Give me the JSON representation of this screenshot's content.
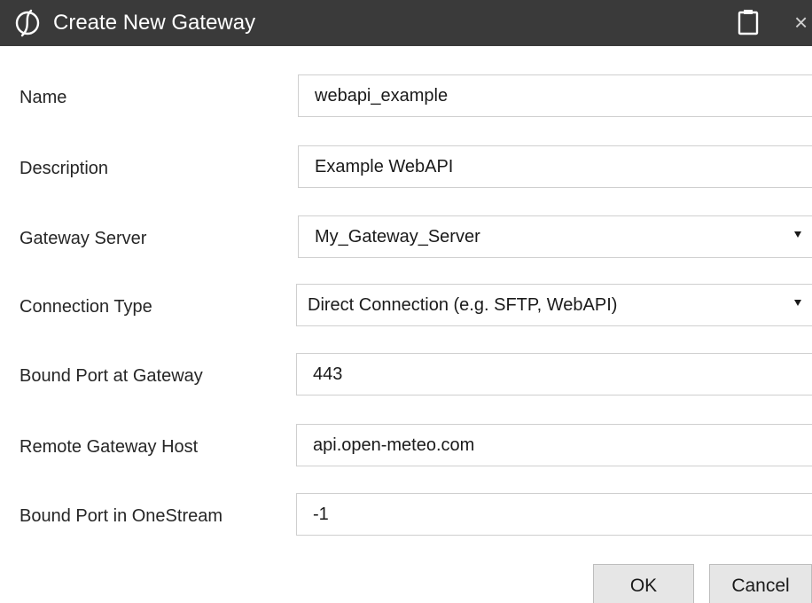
{
  "titlebar": {
    "title": "Create New Gateway",
    "logo_icon": "onestream-logo-icon",
    "restore_icon": "clipboard-icon",
    "close_label": "×",
    "background": "#3a3a3a"
  },
  "form": {
    "name": {
      "label": "Name",
      "value": "webapi_example"
    },
    "description": {
      "label": "Description",
      "value": "Example WebAPI"
    },
    "gateway_server": {
      "label": "Gateway Server",
      "value": "My_Gateway_Server"
    },
    "connection_type": {
      "label": "Connection Type",
      "value": "Direct Connection (e.g. SFTP, WebAPI)"
    },
    "bound_port_gateway": {
      "label": "Bound Port at Gateway",
      "value": "443"
    },
    "remote_host": {
      "label": "Remote Gateway Host",
      "value": "api.open-meteo.com"
    },
    "bound_port_onestream": {
      "label": "Bound Port in OneStream",
      "value": "-1"
    }
  },
  "buttons": {
    "ok": "OK",
    "cancel": "Cancel"
  }
}
